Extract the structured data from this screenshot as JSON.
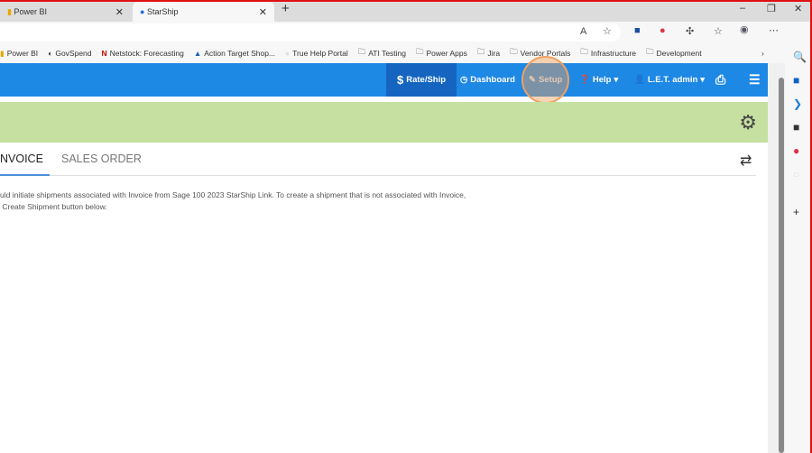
{
  "browser": {
    "tabs": [
      {
        "title": "Power BI"
      },
      {
        "title": "StarShip"
      }
    ],
    "bookmarks": [
      "Power BI",
      "GovSpend",
      "Netstock: Forecasting",
      "Action Target Shop...",
      "True Help Portal",
      "ATI Testing",
      "Power Apps",
      "Jira",
      "Vendor Portals",
      "Infrastructure",
      "Development"
    ]
  },
  "nav": {
    "rate_ship": "Rate/Ship",
    "dashboard": "Dashboard",
    "setup": "Setup",
    "help": "Help",
    "user": "L.E.T. admin"
  },
  "tabs": {
    "invoice": "NVOICE",
    "sales_order": "SALES ORDER"
  },
  "message": {
    "line1": "uld initiate shipments associated with Invoice from Sage 100 2023 StarShip Link. To create a shipment that is not associated with Invoice,",
    "line2": " Create Shipment button below."
  },
  "colors": {
    "nav": "#1e88e5",
    "banner": "#c5e0a0",
    "highlight": "#f0a060"
  }
}
